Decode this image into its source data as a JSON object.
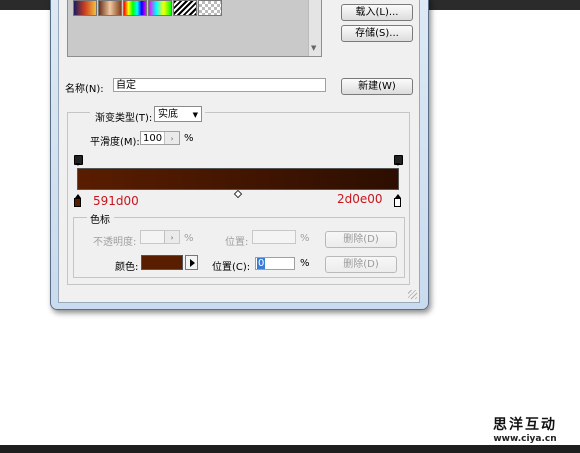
{
  "presets": {
    "swatches": [
      "preset-1",
      "preset-2",
      "preset-3",
      "preset-4",
      "preset-5",
      "preset-6"
    ]
  },
  "buttons": {
    "load": "载入(L)...",
    "save": "存储(S)...",
    "new": "新建(W)"
  },
  "name": {
    "label": "名称(N):",
    "value": "自定"
  },
  "gradient": {
    "type_label": "渐变类型(T):",
    "type_value": "实底",
    "smoothness_label": "平滑度(M):",
    "smoothness_value": "100",
    "smoothness_unit": "%",
    "start_color": "#591d00",
    "end_color": "#2d0e00"
  },
  "annotations": {
    "left_hex": "591d00",
    "right_hex": "2d0e00"
  },
  "stops": {
    "group_title": "色标",
    "opacity_label": "不透明度:",
    "opacity_unit": "%",
    "location_label_top": "位置:",
    "location_unit_top": "%",
    "delete_label_top": "删除(D)",
    "color_label": "颜色:",
    "color_value": "#591d00",
    "location_label": "位置(C):",
    "location_value": "0",
    "location_unit": "%",
    "delete_label": "删除(D)"
  },
  "watermark": {
    "title": "思洋互动",
    "url": "www.ciya.cn"
  }
}
